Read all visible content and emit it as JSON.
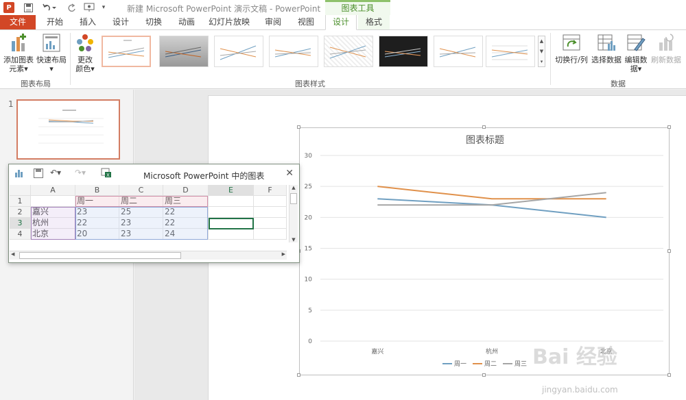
{
  "window": {
    "title": "新建 Microsoft PowerPoint 演示文稿 - PowerPoint",
    "context_group": "图表工具",
    "app_logo": "P"
  },
  "tabs": [
    "文件",
    "开始",
    "插入",
    "设计",
    "切换",
    "动画",
    "幻灯片放映",
    "审阅",
    "视图",
    "设计",
    "格式"
  ],
  "active_tab_index": 9,
  "ribbon": {
    "add_element": [
      "添加图表",
      "元素▾"
    ],
    "quick_layout": [
      "快速布局",
      "▾"
    ],
    "change_color": [
      "更改",
      "颜色▾"
    ],
    "group_chart_layout": "图表布局",
    "group_chart_styles": "图表样式",
    "group_data": "数据",
    "switch_row_col": "切换行/列",
    "select_data": "选择数据",
    "edit_data": [
      "编辑数",
      "据▾"
    ],
    "refresh_data": "刷新数据"
  },
  "slide_panel": {
    "slide_number": "1"
  },
  "data_sheet": {
    "title": "Microsoft PowerPoint 中的图表",
    "close_glyph": "✕",
    "column_headers": [
      "",
      "A",
      "B",
      "C",
      "D",
      "E",
      "F"
    ],
    "row_headers": [
      "1",
      "2",
      "3",
      "4"
    ],
    "rows": [
      [
        "",
        "周一",
        "周二",
        "周三",
        "",
        ""
      ],
      [
        "嘉兴",
        "23",
        "25",
        "22",
        "",
        ""
      ],
      [
        "杭州",
        "22",
        "23",
        "22",
        "",
        ""
      ],
      [
        "北京",
        "20",
        "23",
        "24",
        "",
        ""
      ]
    ]
  },
  "chart_data": {
    "type": "line",
    "title": "图表标题",
    "categories": [
      "嘉兴",
      "杭州",
      "北京"
    ],
    "series": [
      {
        "name": "周一",
        "values": [
          23,
          22,
          20
        ],
        "color": "#6f9fc1"
      },
      {
        "name": "周二",
        "values": [
          25,
          23,
          23
        ],
        "color": "#e0904a"
      },
      {
        "name": "周三",
        "values": [
          22,
          22,
          24
        ],
        "color": "#a5a5a5"
      }
    ],
    "ylim": [
      0,
      30
    ],
    "yticks": [
      0,
      5,
      10,
      15,
      20,
      25,
      30
    ],
    "grid": true,
    "legend": "bottom"
  },
  "watermark": {
    "text": "Bai 经验",
    "url": "jingyan.baidu.com"
  }
}
